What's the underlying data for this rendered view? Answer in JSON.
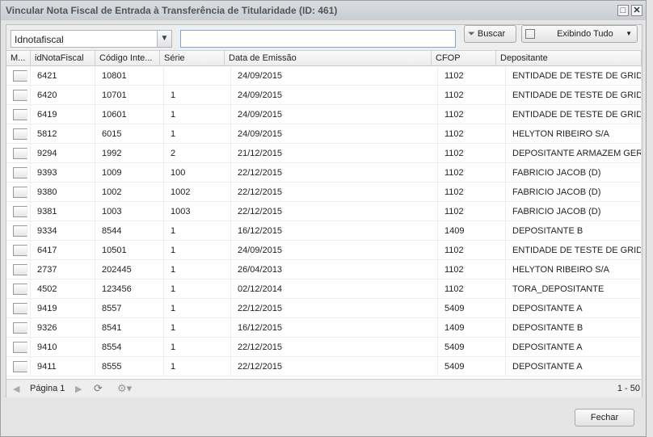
{
  "window": {
    "title": "Vincular Nota Fiscal de Entrada à Transferência de Titularidade (ID: 461)",
    "maximize": "□",
    "close": "✕"
  },
  "toolbar": {
    "field": "Idnotafiscal",
    "search_value": "",
    "search_label": "Buscar",
    "filter_label": "Exibindo Tudo"
  },
  "columns": [
    "M...",
    "idNotaFiscal",
    "Código Inte...",
    "Série",
    "Data de Emissão",
    "CFOP",
    "Depositante"
  ],
  "rows": [
    [
      "6421",
      "10801",
      "",
      "24/09/2015",
      "1102",
      "ENTIDADE DE TESTE DE GRID"
    ],
    [
      "6420",
      "10701",
      "1",
      "24/09/2015",
      "1102",
      "ENTIDADE DE TESTE DE GRID"
    ],
    [
      "6419",
      "10601",
      "1",
      "24/09/2015",
      "1102",
      "ENTIDADE DE TESTE DE GRID"
    ],
    [
      "5812",
      "6015",
      "1",
      "24/09/2015",
      "1102",
      "HELYTON RIBEIRO S/A"
    ],
    [
      "9294",
      "1992",
      "2",
      "21/12/2015",
      "1102",
      "DEPOSITANTE ARMAZEM GERAL"
    ],
    [
      "9393",
      "1009",
      "100",
      "22/12/2015",
      "1102",
      "FABRICIO JACOB (D)"
    ],
    [
      "9380",
      "1002",
      "1002",
      "22/12/2015",
      "1102",
      "FABRICIO JACOB (D)"
    ],
    [
      "9381",
      "1003",
      "1003",
      "22/12/2015",
      "1102",
      "FABRICIO JACOB (D)"
    ],
    [
      "9334",
      "8544",
      "1",
      "16/12/2015",
      "1409",
      "DEPOSITANTE B"
    ],
    [
      "6417",
      "10501",
      "1",
      "24/09/2015",
      "1102",
      "ENTIDADE DE TESTE DE GRID"
    ],
    [
      "2737",
      "202445",
      "1",
      "26/04/2013",
      "1102",
      "HELYTON RIBEIRO S/A"
    ],
    [
      "4502",
      "123456",
      "1",
      "02/12/2014",
      "1102",
      "TORA_DEPOSITANTE"
    ],
    [
      "9419",
      "8557",
      "1",
      "22/12/2015",
      "5409",
      "DEPOSITANTE A"
    ],
    [
      "9326",
      "8541",
      "1",
      "16/12/2015",
      "1409",
      "DEPOSITANTE B"
    ],
    [
      "9410",
      "8554",
      "1",
      "22/12/2015",
      "5409",
      "DEPOSITANTE A"
    ],
    [
      "9411",
      "8555",
      "1",
      "22/12/2015",
      "5409",
      "DEPOSITANTE A"
    ]
  ],
  "pager": {
    "page_label": "Página 1",
    "range": "1 - 50"
  },
  "footer": {
    "close_label": "Fechar"
  }
}
